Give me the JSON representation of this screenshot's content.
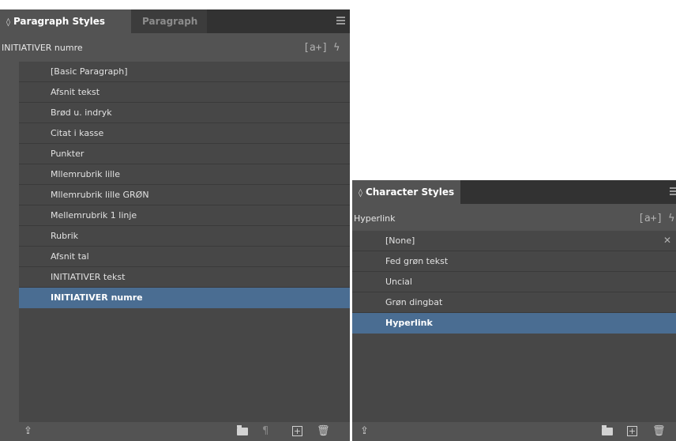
{
  "paragraph_panel": {
    "tabs": [
      {
        "label": "Paragraph Styles",
        "active": true
      },
      {
        "label": "Paragraph",
        "active": false
      }
    ],
    "current_style": "INITIATIVER numre",
    "new_style_icon": "[a+]",
    "styles": [
      "[Basic Paragraph]",
      "Afsnit tekst",
      "Brød u. indryk",
      "Citat i kasse",
      "Punkter",
      "Mllemrubrik lille",
      "Mllemrubrik lille GRØN",
      "Mellemrubrik 1 linje",
      "Rubrik",
      "Afsnit tal",
      "INITIATIVER tekst",
      "INITIATIVER numre"
    ],
    "selected_index": 11,
    "footer_icons": [
      "load-styles-icon",
      "new-group-folder-icon",
      "clear-overrides-icon",
      "new-style-icon",
      "delete-icon"
    ]
  },
  "character_panel": {
    "tabs": [
      {
        "label": "Character Styles",
        "active": true
      }
    ],
    "current_style": "Hyperlink",
    "new_style_icon": "[a+]",
    "styles": [
      "[None]",
      "Fed grøn tekst",
      "Uncial",
      "Grøn dingbat",
      "Hyperlink"
    ],
    "selected_index": 4,
    "footer_icons": [
      "load-styles-icon",
      "new-group-folder-icon",
      "new-style-icon",
      "delete-icon"
    ]
  },
  "colors": {
    "panel_bg": "#535353",
    "list_bg": "#474747",
    "tabbar_bg": "#323232",
    "selection": "#4a6d92"
  }
}
